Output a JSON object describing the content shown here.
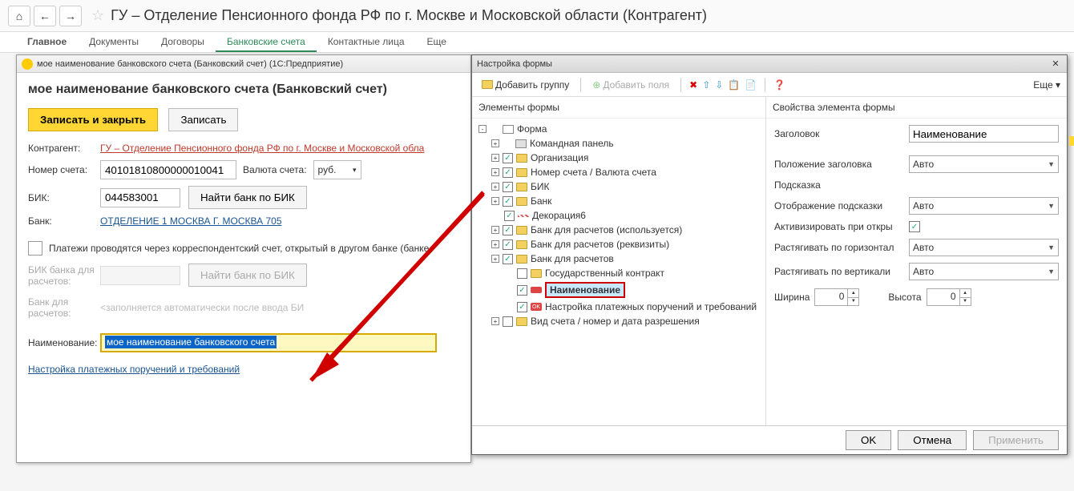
{
  "topbar": {
    "title": "ГУ – Отделение Пенсионного фонда РФ по г. Москве и Московской области (Контрагент)"
  },
  "menubar": {
    "items": [
      "Главное",
      "Документы",
      "Договоры",
      "Банковские счета",
      "Контактные лица",
      "Еще"
    ]
  },
  "left_window": {
    "titlebar": "мое наименование банковского счета (Банковский счет)   (1С:Предприятие)",
    "form_title": "мое наименование банковского счета (Банковский счет)",
    "buttons": {
      "save_close": "Записать и закрыть",
      "save": "Записать"
    },
    "counterparty_label": "Контрагент:",
    "counterparty_value": "ГУ – Отделение Пенсионного фонда РФ по г. Москве и Московской обла",
    "account_label": "Номер счета:",
    "account_value": "40101810800000010041",
    "currency_label": "Валюта счета:",
    "currency_value": "руб.",
    "bik_label": "БИК:",
    "bik_value": "044583001",
    "find_bank_btn": "Найти банк по БИК",
    "bank_label": "Банк:",
    "bank_value": "ОТДЕЛЕНИЕ 1 МОСКВА Г. МОСКВА 705",
    "checkbox_label": "Платежи проводятся через корреспондентский счет, открытый в другом банке (банке",
    "bik2_label": "БИК банка для расчетов:",
    "find_bank2_btn": "Найти банк по БИК",
    "bank2_label": "Банк для расчетов:",
    "bank2_placeholder": "<заполняется автоматически после ввода БИ",
    "name_label": "Наименование:",
    "name_value": "мое наименование банковского счета",
    "settings_link": "Настройка платежных поручений и требований"
  },
  "right_window": {
    "title": "Настройка формы",
    "toolbar": {
      "add_group": "Добавить группу",
      "add_fields": "Добавить поля",
      "more": "Еще"
    },
    "left_header": "Элементы формы",
    "right_header": "Свойства элемента формы",
    "tree": [
      {
        "label": "Форма",
        "indent": 0,
        "ico": "form",
        "exp": "-"
      },
      {
        "label": "Командная панель",
        "indent": 1,
        "ico": "panel",
        "exp": "+"
      },
      {
        "label": "Организация",
        "indent": 1,
        "ico": "folder",
        "exp": "+",
        "check": true
      },
      {
        "label": "Номер счета / Валюта счета",
        "indent": 1,
        "ico": "folder",
        "exp": "+",
        "check": true
      },
      {
        "label": "БИК",
        "indent": 1,
        "ico": "folder",
        "exp": "+",
        "check": true
      },
      {
        "label": "Банк",
        "indent": 1,
        "ico": "folder",
        "exp": "+",
        "check": true
      },
      {
        "label": "Декорация6",
        "indent": 1,
        "ico": "deco",
        "check": true
      },
      {
        "label": "Банк для расчетов (используется)",
        "indent": 1,
        "ico": "folder",
        "exp": "+",
        "check": true
      },
      {
        "label": "Банк для расчетов (реквизиты)",
        "indent": 1,
        "ico": "folder",
        "exp": "+",
        "check": true
      },
      {
        "label": "Банк для расчетов",
        "indent": 1,
        "ico": "folder",
        "exp": "+",
        "check": true
      },
      {
        "label": "Государственный контракт",
        "indent": 2,
        "ico": "folder",
        "check": false
      },
      {
        "label": "Наименование",
        "indent": 2,
        "ico": "item",
        "check": true,
        "highlight": true
      },
      {
        "label": "Настройка платежных поручений и требований",
        "indent": 2,
        "ico": "ok",
        "check": true
      },
      {
        "label": "Вид счета / номер и дата разрешения",
        "indent": 1,
        "ico": "folder",
        "exp": "+",
        "check": false
      }
    ],
    "props": {
      "p1_label": "Заголовок",
      "p1_value": "Наименование",
      "p2_label": "Положение заголовка",
      "p2_value": "Авто",
      "p3_label": "Подсказка",
      "p4_label": "Отображение подсказки",
      "p4_value": "Авто",
      "p5_label": "Активизировать при откры",
      "p6_label": "Растягивать по горизонтал",
      "p6_value": "Авто",
      "p7_label": "Растягивать по вертикали",
      "p7_value": "Авто",
      "w_label": "Ширина",
      "w_value": "0",
      "h_label": "Высота",
      "h_value": "0"
    },
    "footer": {
      "ok": "OK",
      "cancel": "Отмена",
      "apply": "Применить"
    }
  }
}
